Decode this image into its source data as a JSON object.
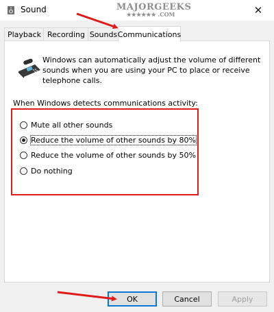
{
  "window": {
    "title": "Sound",
    "icons": {
      "app": "speaker-icon",
      "close": "close-icon"
    }
  },
  "watermark": {
    "brand": "MAJORGEEKS",
    "stars": "★★★★★★ .COM"
  },
  "tabs": [
    {
      "label": "Playback",
      "active": false
    },
    {
      "label": "Recording",
      "active": false
    },
    {
      "label": "Sounds",
      "active": false
    },
    {
      "label": "Communications",
      "active": true
    }
  ],
  "panel": {
    "description": "Windows can automatically adjust the volume of different sounds when you are using your PC to place or receive telephone calls.",
    "section_label": "When Windows detects communications activity:",
    "options": [
      {
        "label": "Mute all other sounds",
        "checked": false
      },
      {
        "label": "Reduce the volume of other sounds by 80%",
        "checked": true
      },
      {
        "label": "Reduce the volume of other sounds by 50%",
        "checked": false
      },
      {
        "label": "Do nothing",
        "checked": false
      }
    ]
  },
  "buttons": {
    "ok": "OK",
    "cancel": "Cancel",
    "apply": "Apply"
  },
  "annotation_color": "#e01919"
}
